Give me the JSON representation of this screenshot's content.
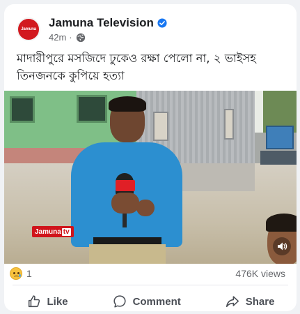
{
  "post": {
    "page_name": "Jamuna Television",
    "avatar_text": "Jamuna",
    "time": "42m",
    "separator": "·",
    "text": "মাদারীপুরে মসজিদে ঢুকেও রক্ষা পেলো না, ২ ভাইসহ তিনজনকে কুপিয়ে হত্যা"
  },
  "media": {
    "watermark_main": "Jamuna",
    "watermark_box": "tv"
  },
  "stats": {
    "reaction_count": "1",
    "views": "476K views"
  },
  "actions": {
    "like_label": "Like",
    "comment_label": "Comment",
    "share_label": "Share"
  },
  "colors": {
    "brand_red": "#d2191f",
    "verified_blue": "#1877f2",
    "text_secondary": "#65676b"
  },
  "icons": [
    "verified-icon",
    "globe-icon",
    "volume-icon",
    "sad-reaction-icon",
    "like-icon",
    "comment-icon",
    "share-icon"
  ]
}
